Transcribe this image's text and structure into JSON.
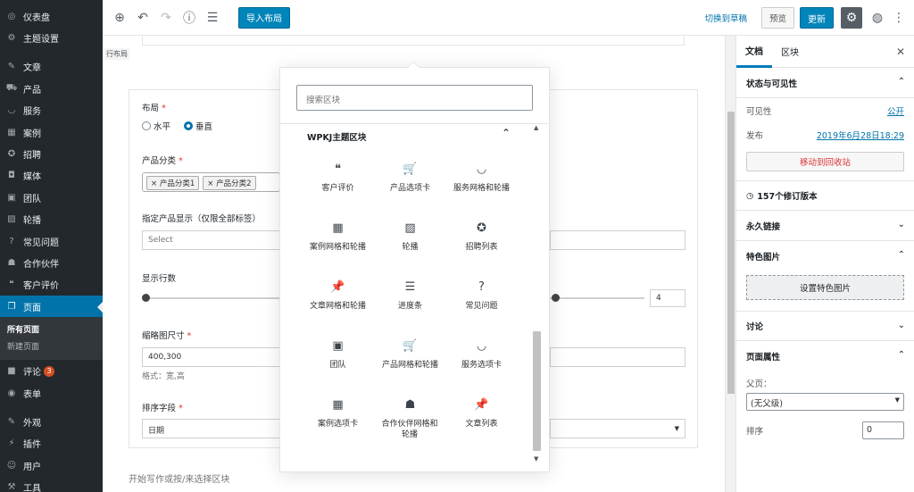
{
  "admin_menu": {
    "items": [
      {
        "icon": "speedometer-icon",
        "glyph": "◎",
        "label": "仪表盘"
      },
      {
        "icon": "gear-icon",
        "glyph": "⚙",
        "label": "主题设置"
      },
      {
        "icon": "pin-icon",
        "glyph": "📌",
        "label": "文章"
      },
      {
        "icon": "cart-icon",
        "glyph": "🛒",
        "label": "产品"
      },
      {
        "icon": "smile-icon",
        "glyph": "◡",
        "label": "服务"
      },
      {
        "icon": "grid-icon",
        "glyph": "▦",
        "label": "案例"
      },
      {
        "icon": "universal-access-icon",
        "glyph": "✪",
        "label": "招聘"
      },
      {
        "icon": "media-icon",
        "glyph": "◘",
        "label": "媒体"
      },
      {
        "icon": "id-card-icon",
        "glyph": "▣",
        "label": "团队"
      },
      {
        "icon": "images-icon",
        "glyph": "▨",
        "label": "轮播"
      },
      {
        "icon": "help-icon",
        "glyph": "?",
        "label": "常见问题"
      },
      {
        "icon": "groups-icon",
        "glyph": "☗",
        "label": "合作伙伴"
      },
      {
        "icon": "quote-icon",
        "glyph": "❝",
        "label": "客户评价"
      },
      {
        "icon": "pages-icon",
        "glyph": "❐",
        "label": "页面"
      },
      {
        "icon": "comment-icon",
        "glyph": "■",
        "label": "评论",
        "badge": "3"
      },
      {
        "icon": "feedback-icon",
        "glyph": "◉",
        "label": "表单"
      },
      {
        "icon": "appearance-icon",
        "glyph": "✎",
        "label": "外观"
      },
      {
        "icon": "plugins-icon",
        "glyph": "⚡",
        "label": "插件"
      },
      {
        "icon": "users-icon",
        "glyph": "👤",
        "label": "用户"
      },
      {
        "icon": "tools-icon",
        "glyph": "🔧",
        "label": "工具"
      }
    ],
    "submenu": [
      "所有页面",
      "新建页面"
    ]
  },
  "toolbar": {
    "import_layout": "导入布局",
    "switch_draft": "切换到草稿",
    "preview": "预览",
    "update": "更新"
  },
  "editor": {
    "crumb": "行布局",
    "layout_label": "布局",
    "radio_horizontal": "水平",
    "radio_vertical": "垂直",
    "category_label": "产品分类",
    "tag1": "产品分类1",
    "tag2": "产品分类2",
    "specific_label": "指定产品显示（仅限全部标签）",
    "select_placeholder": "Select",
    "rows_label": "显示行数",
    "rows_value": "4",
    "thumb_label": "缩略图尺寸",
    "thumb_value": "400,300",
    "thumb_hint": "格式：宽,高",
    "sort_label": "排序字段",
    "sort_value": "日期",
    "appender": "开始写作或按/来选择区块"
  },
  "inserter": {
    "search_placeholder": "搜索区块",
    "panel_title": "WPKJ主题区块",
    "blocks": [
      {
        "icon": "quote-icon",
        "glyph": "❝",
        "label": "客户评价"
      },
      {
        "icon": "cart-icon",
        "glyph": "🛒",
        "label": "产品选项卡"
      },
      {
        "icon": "smile-icon",
        "glyph": "◡",
        "label": "服务网格和轮播"
      },
      {
        "icon": "grid-icon",
        "glyph": "▦",
        "label": "案例网格和轮播"
      },
      {
        "icon": "images-icon",
        "glyph": "▨",
        "label": "轮播"
      },
      {
        "icon": "universal-access-icon",
        "glyph": "✪",
        "label": "招聘列表"
      },
      {
        "icon": "pin-icon",
        "glyph": "📌",
        "label": "文章网格和轮播"
      },
      {
        "icon": "align-left-icon",
        "glyph": "☰",
        "label": "进度条"
      },
      {
        "icon": "help-icon",
        "glyph": "?",
        "label": "常见问题"
      },
      {
        "icon": "id-card-icon",
        "glyph": "▣",
        "label": "团队"
      },
      {
        "icon": "cart-icon",
        "glyph": "🛒",
        "label": "产品网格和轮播"
      },
      {
        "icon": "smile-icon",
        "glyph": "◡",
        "label": "服务选项卡"
      },
      {
        "icon": "grid-icon",
        "glyph": "▦",
        "label": "案例选项卡"
      },
      {
        "icon": "groups-icon",
        "glyph": "☗",
        "label": "合作伙伴网格和轮播"
      },
      {
        "icon": "pin-icon",
        "glyph": "📌",
        "label": "文章列表"
      }
    ]
  },
  "settings": {
    "tab_document": "文档",
    "tab_block": "区块",
    "status_title": "状态与可见性",
    "visibility_label": "可见性",
    "visibility_value": "公开",
    "publish_label": "发布",
    "publish_value": "2019年6月28日18:29",
    "trash_label": "移动到回收站",
    "revisions": "157个修订版本",
    "permalink": "永久链接",
    "featured_title": "特色图片",
    "featured_button": "设置特色图片",
    "discussion": "讨论",
    "page_attributes": "页面属性",
    "parent_label": "父页：",
    "parent_value": "(无父级)",
    "order_label": "排序",
    "order_value": "0"
  }
}
